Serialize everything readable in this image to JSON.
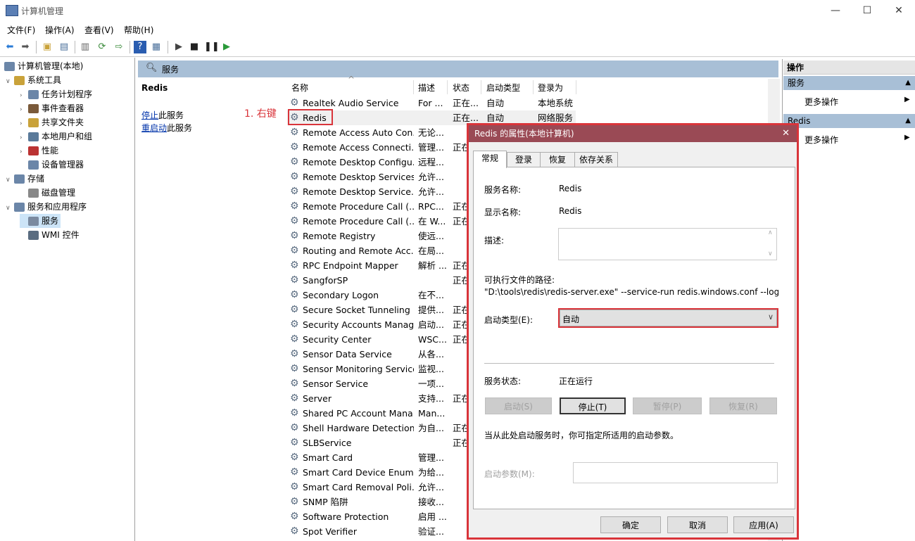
{
  "window": {
    "title": "计算机管理",
    "minimize": "—",
    "maximize": "☐",
    "close": "✕"
  },
  "menu": [
    "文件(F)",
    "操作(A)",
    "查看(V)",
    "帮助(H)"
  ],
  "tree": {
    "root": "计算机管理(本地)",
    "items": [
      {
        "label": "系统工具",
        "indent": 1,
        "expander": "∨"
      },
      {
        "label": "任务计划程序",
        "indent": 2,
        "expander": "›"
      },
      {
        "label": "事件查看器",
        "indent": 2,
        "expander": "›"
      },
      {
        "label": "共享文件夹",
        "indent": 2,
        "expander": "›"
      },
      {
        "label": "本地用户和组",
        "indent": 2,
        "expander": "›"
      },
      {
        "label": "性能",
        "indent": 2,
        "expander": "›"
      },
      {
        "label": "设备管理器",
        "indent": 2,
        "expander": ""
      },
      {
        "label": "存储",
        "indent": 1,
        "expander": "∨"
      },
      {
        "label": "磁盘管理",
        "indent": 2,
        "expander": ""
      },
      {
        "label": "服务和应用程序",
        "indent": 1,
        "expander": "∨"
      },
      {
        "label": "服务",
        "indent": 2,
        "expander": "",
        "selected": true
      },
      {
        "label": "WMI 控件",
        "indent": 2,
        "expander": ""
      }
    ]
  },
  "services_panel": {
    "title": "服务",
    "selected_name": "Redis",
    "stop_link": "停止",
    "stop_suffix": "此服务",
    "restart_link": "重启动",
    "restart_suffix": "此服务",
    "annotation": "1. 右键"
  },
  "list": {
    "sort_indicator": "^",
    "columns": [
      "名称",
      "描述",
      "状态",
      "启动类型",
      "登录为"
    ],
    "rows": [
      [
        "Realtek Audio Service",
        "For ...",
        "正在...",
        "自动",
        "本地系统"
      ],
      [
        "Redis",
        "",
        "正在...",
        "自动",
        "网络服务"
      ],
      [
        "Remote Access Auto Con...",
        "无论...",
        "",
        "",
        ""
      ],
      [
        "Remote Access Connecti...",
        "管理...",
        "正在",
        "",
        ""
      ],
      [
        "Remote Desktop Configu...",
        "远程...",
        "",
        "",
        ""
      ],
      [
        "Remote Desktop Services",
        "允许...",
        "",
        "",
        ""
      ],
      [
        "Remote Desktop Service...",
        "允许...",
        "",
        "",
        ""
      ],
      [
        "Remote Procedure Call (...",
        "RPC...",
        "正在",
        "",
        ""
      ],
      [
        "Remote Procedure Call (...",
        "在 W...",
        "正在",
        "",
        ""
      ],
      [
        "Remote Registry",
        "使远...",
        "",
        "",
        ""
      ],
      [
        "Routing and Remote Acc...",
        "在局...",
        "",
        "",
        ""
      ],
      [
        "RPC Endpoint Mapper",
        "解析 ...",
        "正在",
        "",
        ""
      ],
      [
        "SangforSP",
        "",
        "正在",
        "",
        ""
      ],
      [
        "Secondary Logon",
        "在不...",
        "",
        "",
        ""
      ],
      [
        "Secure Socket Tunneling ...",
        "提供...",
        "正在",
        "",
        ""
      ],
      [
        "Security Accounts Manag...",
        "启动...",
        "正在",
        "",
        ""
      ],
      [
        "Security Center",
        "WSC...",
        "正在",
        "",
        ""
      ],
      [
        "Sensor Data Service",
        "从各...",
        "",
        "",
        ""
      ],
      [
        "Sensor Monitoring Service",
        "监视...",
        "",
        "",
        ""
      ],
      [
        "Sensor Service",
        "一项...",
        "",
        "",
        ""
      ],
      [
        "Server",
        "支持...",
        "正在",
        "",
        ""
      ],
      [
        "Shared PC Account Mana...",
        "Man...",
        "",
        "",
        ""
      ],
      [
        "Shell Hardware Detection",
        "为自...",
        "正在",
        "",
        ""
      ],
      [
        "SLBService",
        "",
        "正在",
        "",
        ""
      ],
      [
        "Smart Card",
        "管理...",
        "",
        "",
        ""
      ],
      [
        "Smart Card Device Enum...",
        "为给...",
        "",
        "",
        ""
      ],
      [
        "Smart Card Removal Poli...",
        "允许...",
        "",
        "",
        ""
      ],
      [
        "SNMP 陷阱",
        "接收...",
        "",
        "",
        ""
      ],
      [
        "Software Protection",
        "启用 ...",
        "",
        "",
        ""
      ],
      [
        "Spot Verifier",
        "验证...",
        "",
        "",
        ""
      ]
    ]
  },
  "actions": {
    "header": "操作",
    "sections": [
      {
        "title": "服务",
        "item": "更多操作"
      },
      {
        "title": "Redis",
        "item": "更多操作"
      }
    ]
  },
  "dialog": {
    "title": "Redis 的属性(本地计算机)",
    "tabs": [
      "常规",
      "登录",
      "恢复",
      "依存关系"
    ],
    "service_name_label": "服务名称:",
    "service_name": "Redis",
    "display_name_label": "显示名称:",
    "display_name": "Redis",
    "description_label": "描述:",
    "description": "",
    "path_label": "可执行文件的路径:",
    "path": "\"D:\\tools\\redis\\redis-server.exe\" --service-run redis.windows.conf --logl",
    "startup_type_label": "启动类型(E):",
    "startup_type": "自动",
    "status_label": "服务状态:",
    "status": "正在运行",
    "buttons": {
      "start": "启动(S)",
      "stop": "停止(T)",
      "pause": "暂停(P)",
      "resume": "恢复(R)"
    },
    "hint": "当从此处启动服务时，你可指定所适用的启动参数。",
    "params_label": "启动参数(M):",
    "params_value": "",
    "footer": {
      "ok": "确定",
      "cancel": "取消",
      "apply": "应用(A)"
    }
  }
}
